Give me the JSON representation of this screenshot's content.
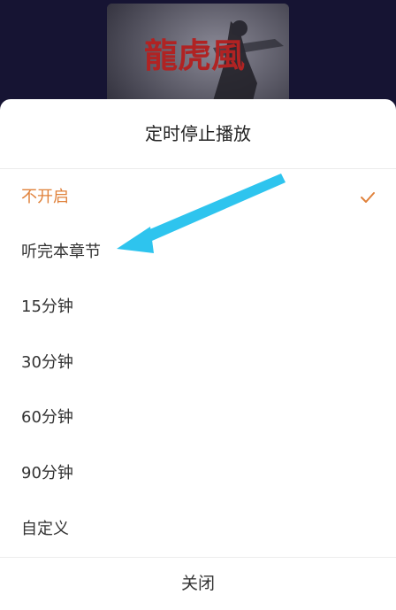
{
  "cover": {
    "title_art": "龍虎風"
  },
  "sheet": {
    "title": "定时停止播放",
    "options": [
      {
        "label": "不开启",
        "selected": true
      },
      {
        "label": "听完本章节",
        "selected": false
      },
      {
        "label": "15分钟",
        "selected": false
      },
      {
        "label": "30分钟",
        "selected": false
      },
      {
        "label": "60分钟",
        "selected": false
      },
      {
        "label": "90分钟",
        "selected": false
      },
      {
        "label": "自定义",
        "selected": false
      }
    ],
    "close_label": "关闭"
  },
  "colors": {
    "accent": "#e0813a",
    "arrow": "#2ec4ee",
    "backdrop": "#161433"
  },
  "icons": {
    "selected": "check-icon",
    "annotation": "arrow-annotation"
  }
}
